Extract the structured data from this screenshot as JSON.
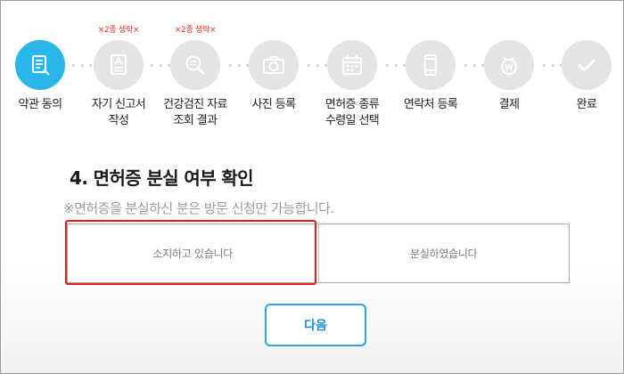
{
  "steps": [
    {
      "icon": "document-check-icon",
      "label": [
        "약관 동의"
      ],
      "note": "",
      "active": true
    },
    {
      "icon": "self-report-icon",
      "label": [
        "자기 신고서",
        "작성"
      ],
      "note": "×2종 생략×",
      "active": false
    },
    {
      "icon": "search-document-icon",
      "label": [
        "건강검진 자료",
        "조회 결과"
      ],
      "note": "×2종 생략×",
      "active": false
    },
    {
      "icon": "camera-icon",
      "label": [
        "사진 등록"
      ],
      "note": "",
      "active": false
    },
    {
      "icon": "calendar-icon",
      "label": [
        "면허증 종류",
        "수령일 선택"
      ],
      "note": "",
      "active": false
    },
    {
      "icon": "phone-icon",
      "label": [
        "연락처 등록"
      ],
      "note": "",
      "active": false
    },
    {
      "icon": "won-coin-icon",
      "label": [
        "결제"
      ],
      "note": "",
      "active": false
    },
    {
      "icon": "checkmark-icon",
      "label": [
        "완료"
      ],
      "note": "",
      "active": false
    }
  ],
  "section": {
    "title": "4. 면허증 분실 여부 확인",
    "note": "※면허증을 분실하신 분은 방문 신청만 가능합니다."
  },
  "options": {
    "have": "소지하고 있습니다",
    "lost": "분실하였습니다",
    "highlighted": "have"
  },
  "next_button": "다음",
  "colors": {
    "active_step": "#29b6e8",
    "inactive_step": "#e4e4e4",
    "note_red": "#e0312a",
    "highlight_red": "#e21b1b",
    "button_blue": "#28a7e1"
  }
}
